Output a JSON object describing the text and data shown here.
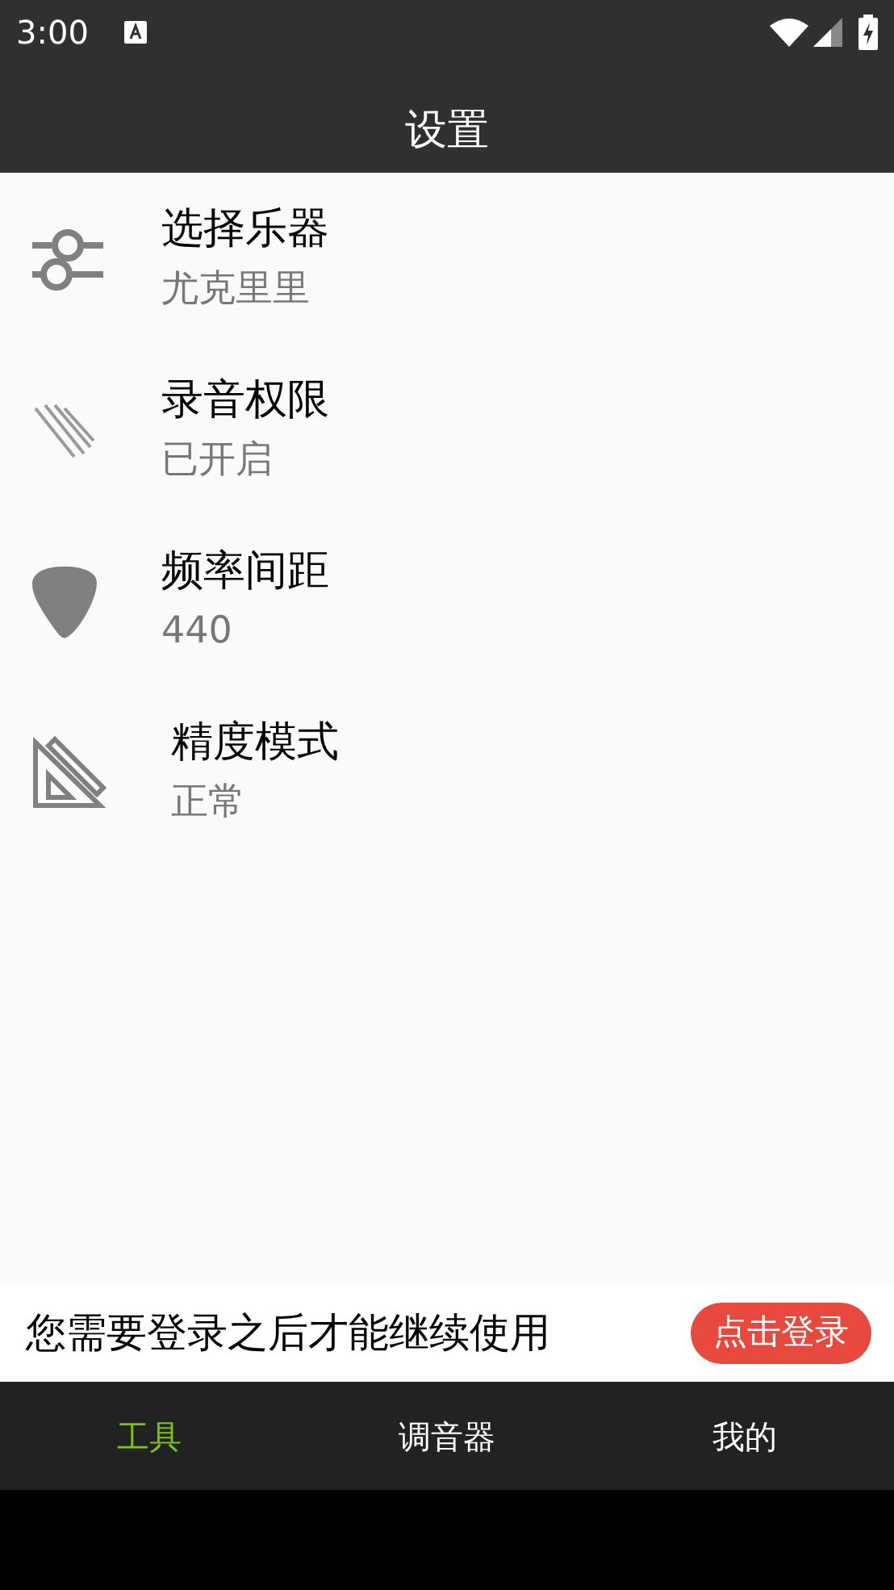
{
  "status_bar": {
    "time": "3:00"
  },
  "app_bar": {
    "title": "设置"
  },
  "settings": [
    {
      "kind": "sliders",
      "title": "选择乐器",
      "value": "尤克里里"
    },
    {
      "kind": "lines",
      "title": "录音权限",
      "value": "已开启"
    },
    {
      "kind": "pick",
      "title": "频率间距",
      "value": "440"
    },
    {
      "kind": "ruler",
      "title": "精度模式",
      "value": "正常"
    }
  ],
  "login_banner": {
    "message": "您需要登录之后才能继续使用",
    "button": "点击登录"
  },
  "tabs": [
    {
      "label": "工具",
      "selected": true
    },
    {
      "label": "调音器",
      "selected": false
    },
    {
      "label": "我的",
      "selected": false
    }
  ]
}
